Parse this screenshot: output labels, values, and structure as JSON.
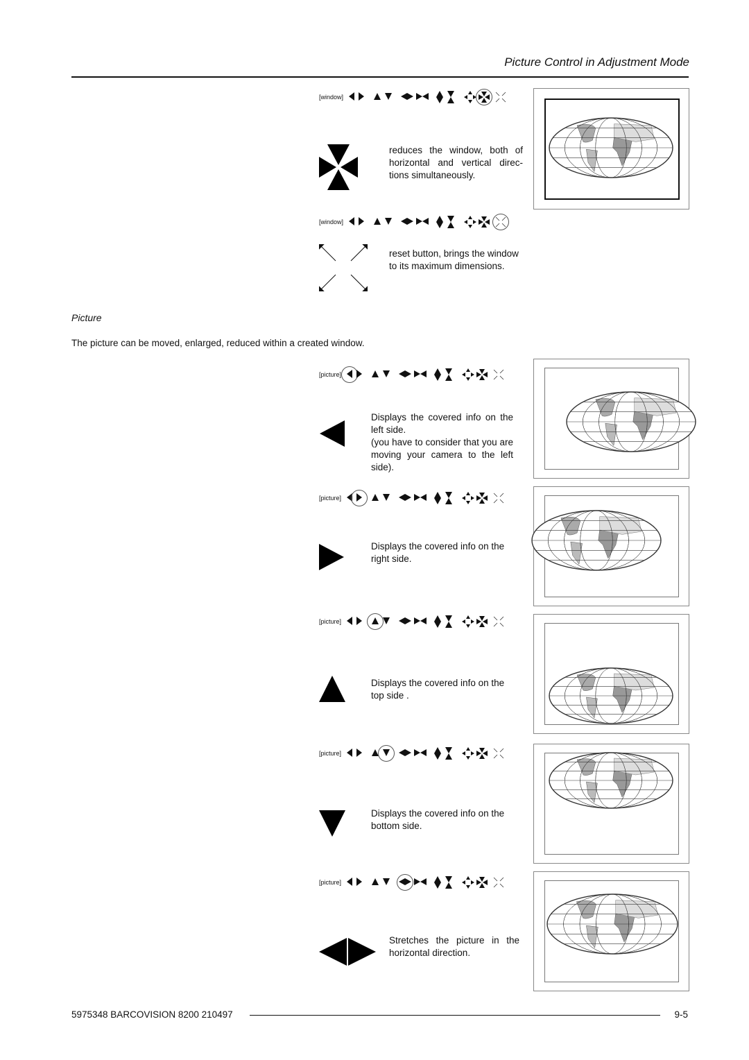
{
  "header": {
    "title": "Picture Control in Adjustment Mode"
  },
  "toolbar_icons": [
    "arrow-left",
    "arrow-right",
    "arrow-up",
    "arrow-down",
    "stretch-horizontal",
    "shrink-horizontal",
    "stretch-vertical",
    "shrink-vertical",
    "enlarge",
    "reduce",
    "reset"
  ],
  "window_rows": [
    {
      "label": "[window]",
      "selected": "reduce",
      "description": "reduces the window, both of horizontal and vertical direc-tions simultaneously."
    },
    {
      "label": "[window]",
      "selected": "reset",
      "description": "reset button, brings the window to its maximum dimensions."
    }
  ],
  "section": {
    "title": "Picture",
    "intro": "The picture can be moved, enlarged, reduced within a created window."
  },
  "picture_rows": [
    {
      "label": "[picture]",
      "selected": "arrow-left",
      "description": "Displays the covered info on the left side.",
      "note": "(you have to consider that you are moving your camera to the left side)."
    },
    {
      "label": "[picture]",
      "selected": "arrow-right",
      "description": "Displays the covered info on the right side."
    },
    {
      "label": "[picture]",
      "selected": "arrow-up",
      "description": "Displays the covered info on the top side ."
    },
    {
      "label": "[picture]",
      "selected": "arrow-down",
      "description": "Displays the covered info on the bottom side."
    },
    {
      "label": "[picture]",
      "selected": "stretch-horizontal",
      "description": "Stretches the picture in the horizontal direction."
    }
  ],
  "footer": {
    "left": "5975348 BARCOVISION 8200 210497",
    "right": "9-5"
  }
}
